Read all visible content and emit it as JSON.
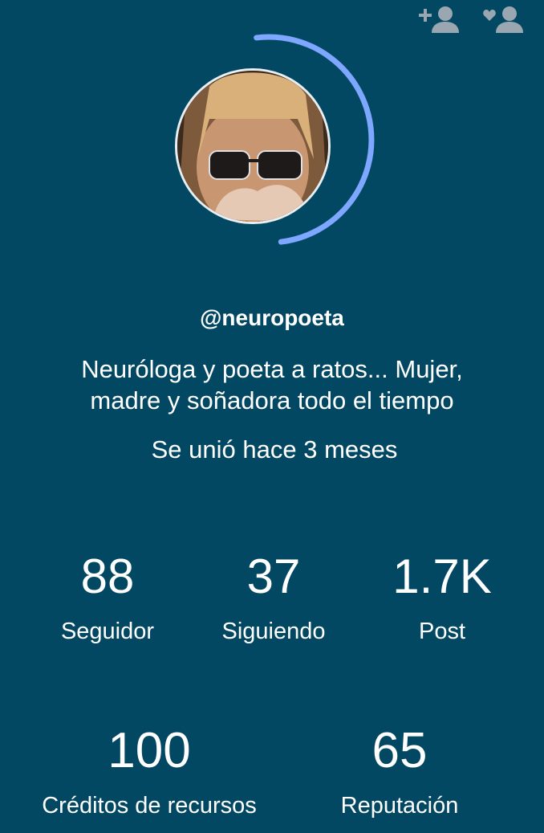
{
  "profile": {
    "username": "@neuropoeta",
    "bio_line1": "Neuróloga y poeta a ratos... Mujer,",
    "bio_line2": "madre y soñadora todo el tiempo",
    "joined": "Se unió hace 3 meses",
    "level_progress": 0.5
  },
  "stats": [
    {
      "value": "88",
      "label": "Seguidor"
    },
    {
      "value": "37",
      "label": "Siguiendo"
    },
    {
      "value": "1.7K",
      "label": "Post"
    },
    {
      "value": "100",
      "label": "Créditos de recursos"
    },
    {
      "value": "65",
      "label": "Reputación"
    }
  ],
  "icons": {
    "follow": "add-user-icon",
    "favorite": "favorite-user-icon"
  },
  "colors": {
    "background": "#034863",
    "ring": "#7ea7ff",
    "icon": "#9aa7b0",
    "text": "#ffffff"
  }
}
